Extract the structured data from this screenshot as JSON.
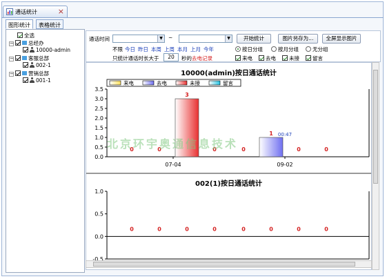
{
  "window": {
    "tab_title": "通话统计"
  },
  "tabs": [
    {
      "label": "图形统计"
    },
    {
      "label": "表格统计"
    }
  ],
  "tree": {
    "select_all": "全选",
    "nodes": [
      {
        "label": "总经办",
        "children": [
          "10000-admin"
        ]
      },
      {
        "label": "客服总部",
        "children": [
          "002-1"
        ]
      },
      {
        "label": "营销总部",
        "children": [
          "001-1"
        ]
      }
    ]
  },
  "toolbar": {
    "time_label": "通话时间",
    "range_sep": "~",
    "start_button": "开始统计",
    "save_image_button": "图片另存为...",
    "fullscreen_button": "全屏显示图片",
    "quick_unlimited": "不限",
    "quick_periods": [
      "今日",
      "昨日",
      "本周",
      "上周",
      "本月",
      "上月",
      "今年"
    ],
    "duration_label": "只统计通话时长大于",
    "duration_value": "20",
    "duration_suffix": "秒的",
    "duration_suffix_red": "去电记录",
    "group_options": [
      "按日分组",
      "按月分组",
      "无分组"
    ],
    "group_selected": 0,
    "filters": [
      "来电",
      "去电",
      "未接",
      "留言"
    ]
  },
  "watermark": "北京环宇奥通信息技术",
  "colors": {
    "incoming": "#ffe05a",
    "outgoing": "#6f6ff0",
    "missed": "#e83030",
    "message": "#20c0e0"
  },
  "chart_data": [
    {
      "type": "bar",
      "title": "10000(admin)按日通话统计",
      "legend": [
        "来电",
        "去电",
        "未接",
        "留言"
      ],
      "legend_placement": "top-left",
      "categories": [
        "07-04",
        "09-02"
      ],
      "series": [
        {
          "name": "来电",
          "values": [
            0,
            0
          ]
        },
        {
          "name": "去电",
          "values": [
            0,
            1
          ]
        },
        {
          "name": "未接",
          "values": [
            3,
            0
          ]
        },
        {
          "name": "留言",
          "values": [
            0,
            0
          ]
        }
      ],
      "bar_labels": [
        "0",
        "0",
        "3",
        "0",
        "0",
        "1",
        "0",
        "0"
      ],
      "extra_label": "00:47",
      "yticks": [
        "0.0",
        "0.5",
        "1.0",
        "1.5",
        "2.0",
        "2.5",
        "3.0",
        "3.5"
      ],
      "ylim": [
        0,
        3.5
      ],
      "grid": false
    },
    {
      "type": "bar",
      "title": "002(1)按日通话统计",
      "categories": [],
      "series": [],
      "bar_labels": [
        "0",
        "0",
        "0",
        "0",
        "0",
        "0",
        "0",
        "0"
      ],
      "yticks": [
        "1.0",
        "0.5",
        "0.0",
        "-0.5"
      ],
      "ylim": [
        -0.5,
        1.0
      ],
      "grid": false
    }
  ]
}
